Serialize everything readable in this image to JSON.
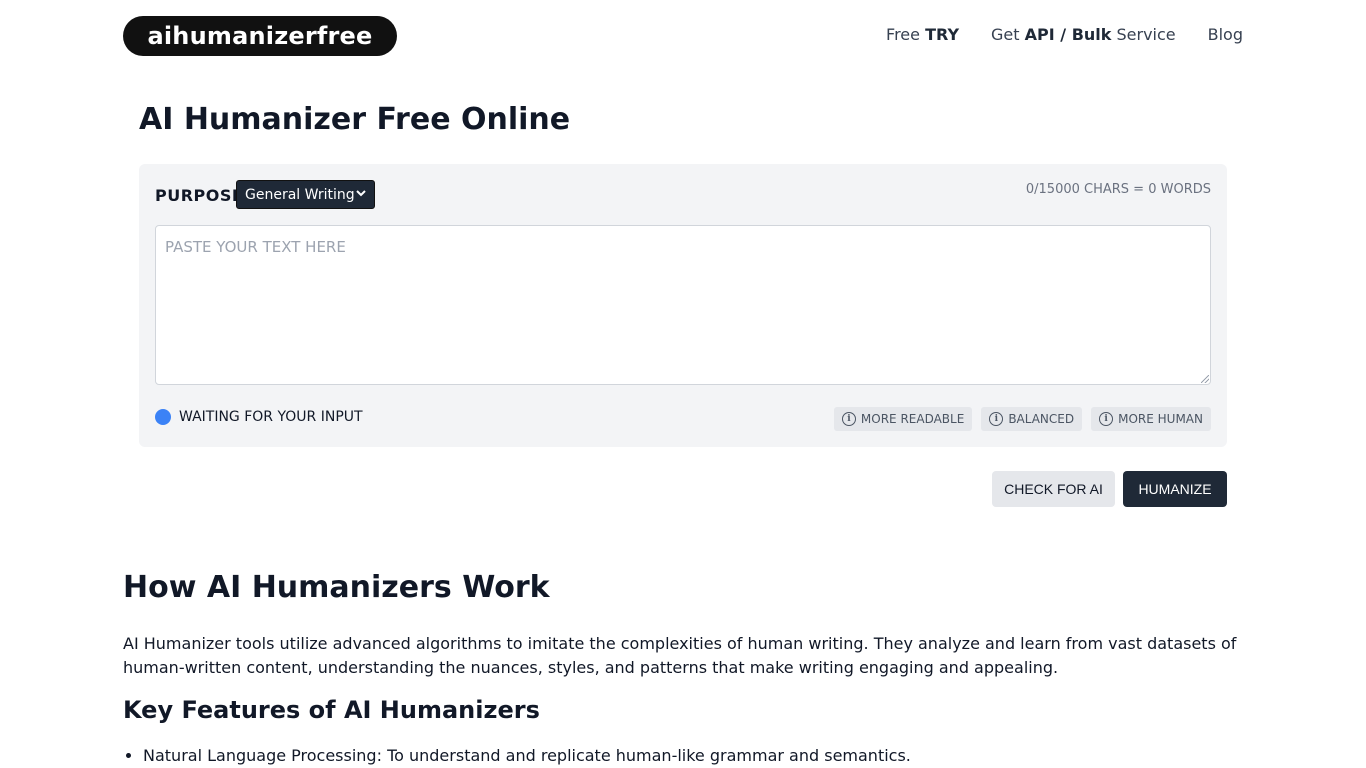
{
  "header": {
    "logo_text": "aihumanizerfree",
    "nav": [
      {
        "prefix": "Free ",
        "bold": "TRY",
        "suffix": ""
      },
      {
        "prefix": "Get ",
        "bold": "API / Bulk",
        "suffix": " Service"
      },
      {
        "prefix": "Blog",
        "bold": "",
        "suffix": ""
      }
    ]
  },
  "tool": {
    "title": "AI Humanizer Free Online",
    "purpose_label": "PURPOSE",
    "purpose_selected": "General Writing",
    "counter": "0/15000 CHARS = 0 WORDS",
    "input_placeholder": "PASTE YOUR TEXT HERE",
    "input_value": "",
    "status_text": "WAITING FOR YOUR INPUT",
    "status_color": "#3b82f6",
    "modes": [
      "MORE READABLE",
      "BALANCED",
      "MORE HUMAN"
    ],
    "check_label": "CHECK FOR AI",
    "humanize_label": "HUMANIZE"
  },
  "article": {
    "heading": "How AI Humanizers Work",
    "paragraph": "AI Humanizer tools utilize advanced algorithms to imitate the complexities of human writing. They analyze and learn from vast datasets of human-written content, understanding the nuances, styles, and patterns that make writing engaging and appealing.",
    "subheading": "Key Features of AI Humanizers",
    "features": [
      "Natural Language Processing: To understand and replicate human-like grammar and semantics."
    ]
  },
  "colors": {
    "primary_dark": "#1f2937",
    "panel_bg": "#f3f4f6",
    "accent_blue": "#3b82f6"
  }
}
